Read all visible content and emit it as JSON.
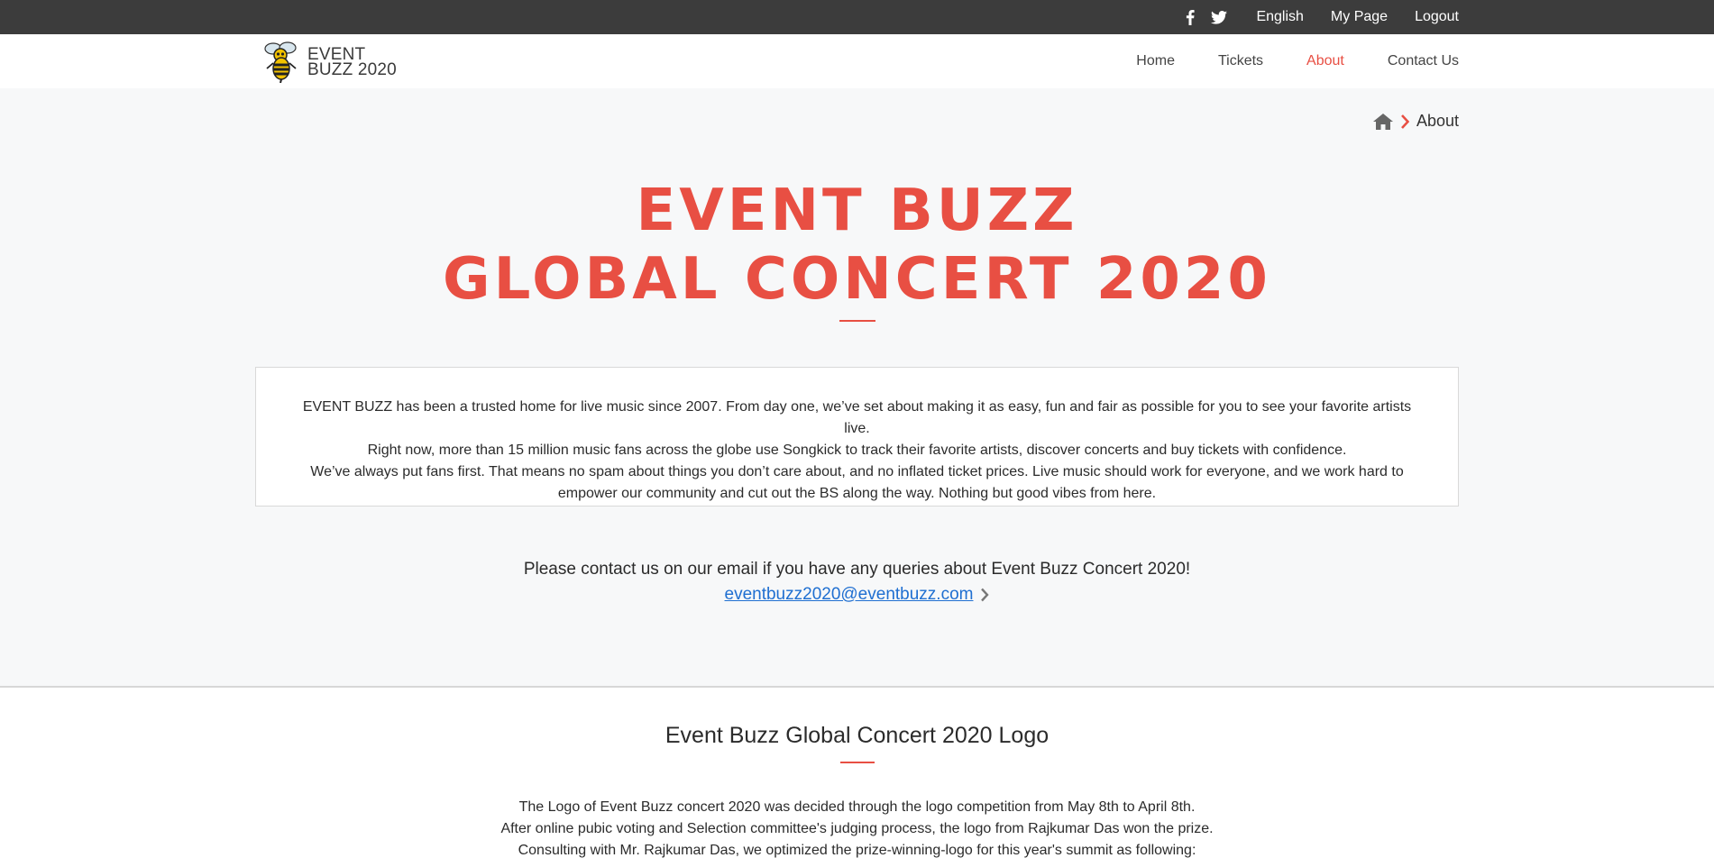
{
  "topbar": {
    "links": [
      "English",
      "My Page",
      "Logout"
    ],
    "icons": [
      "facebook-icon",
      "twitter-icon"
    ]
  },
  "header": {
    "logo_line1": "EVENT",
    "logo_line2": "BUZZ 2020",
    "nav": [
      "Home",
      "Tickets",
      "About",
      "Contact Us"
    ],
    "active_nav": "About"
  },
  "breadcrumb": {
    "current": "About"
  },
  "hero": {
    "title_line1": "EVENT BUZZ",
    "title_line2": "GLOBAL CONCERT 2020",
    "intro": [
      "EVENT BUZZ has been a trusted home for live music since 2007. From day one, we’ve set about making it as easy, fun and fair as possible for you to see your favorite artists live.",
      "Right now, more than 15 million music fans across the globe use Songkick to track their favorite artists, discover concerts and buy tickets with confidence.",
      "We’ve always put fans first. That means no spam about things you don’t care about, and no inflated ticket prices. Live music should work for everyone, and we work hard to empower our community and cut out the BS along the way. Nothing but good vibes from here."
    ],
    "contact_text": "Please contact us on our email if you have any queries about Event Buzz Concert 2020!",
    "email": "eventbuzz2020@eventbuzz.com"
  },
  "logo_section": {
    "title": "Event Buzz Global Concert 2020 Logo",
    "lines": [
      "The Logo of Event Buzz concert 2020 was decided through the logo competition from May 8th to April 8th.",
      "After online pubic voting and Selection committee's judging process, the logo from Rajkumar Das won the prize.",
      "Consulting with Mr. Rajkumar Das, we optimized the prize-winning-logo for this year's summit as following:"
    ]
  },
  "colors": {
    "accent": "#e84f43",
    "topbar_bg": "#3c3c3c",
    "link": "#1f6fd1"
  }
}
